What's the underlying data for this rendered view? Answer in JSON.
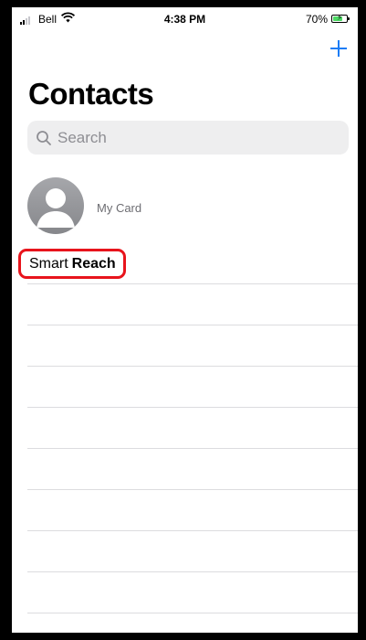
{
  "status_bar": {
    "carrier": "Bell",
    "time": "4:38 PM",
    "battery_percent": "70%",
    "battery_level": 0.7,
    "signal_bars_filled": 2
  },
  "nav": {
    "add_icon": "plus-icon",
    "accent_color": "#1a7cf5"
  },
  "page": {
    "title": "Contacts"
  },
  "search": {
    "placeholder": "Search",
    "value": ""
  },
  "my_card": {
    "label": "My Card"
  },
  "contacts": [
    {
      "first_name": "Smart",
      "last_name": "Reach",
      "highlighted": true,
      "highlight_color": "#e8141c"
    }
  ]
}
